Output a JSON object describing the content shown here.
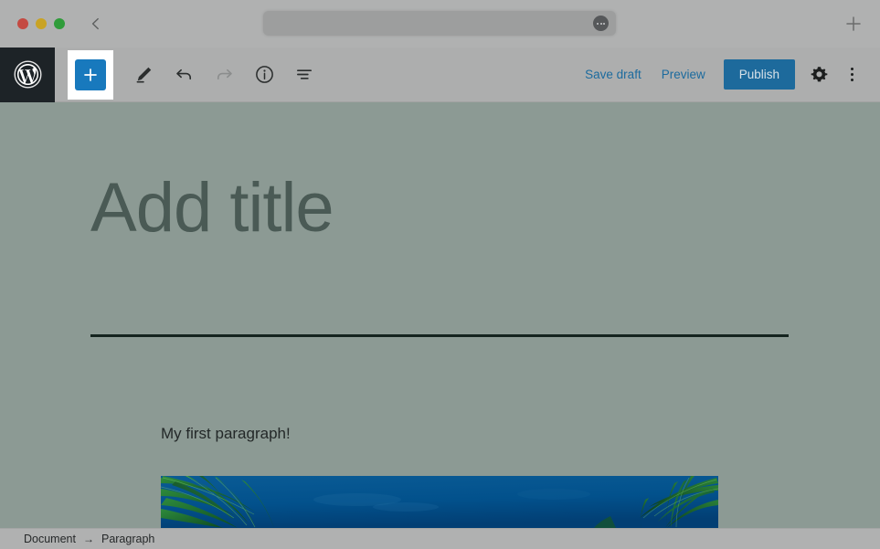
{
  "browser": {
    "traffic_lights": [
      {
        "name": "close",
        "color": "#c44a42"
      },
      {
        "name": "minimize",
        "color": "#c9a324"
      },
      {
        "name": "maximize",
        "color": "#2f9c3a"
      }
    ],
    "back_icon": "chevron-left-icon",
    "address_bar": {
      "value": "",
      "placeholder": "",
      "menu_icon": "ellipsis-icon"
    },
    "new_tab_icon": "plus-icon"
  },
  "editor_header": {
    "logo_icon": "wordpress-logo-icon",
    "left_tools": [
      {
        "name": "block-inserter",
        "icon": "plus-icon",
        "label": "Add block",
        "state": "focused"
      },
      {
        "name": "tools-mode",
        "icon": "pencil-icon",
        "label": "Tools"
      },
      {
        "name": "undo",
        "icon": "undo-icon",
        "label": "Undo",
        "state": "enabled"
      },
      {
        "name": "redo",
        "icon": "redo-icon",
        "label": "Redo",
        "state": "disabled"
      },
      {
        "name": "details",
        "icon": "info-icon",
        "label": "Details"
      },
      {
        "name": "list-view",
        "icon": "list-view-icon",
        "label": "List view"
      }
    ],
    "save_draft_label": "Save draft",
    "preview_label": "Preview",
    "publish_label": "Publish",
    "settings_icon": "gear-icon",
    "more_menu_icon": "kebab-menu-icon",
    "accent_color": "#1879bd",
    "publish_color": "#1d6a9c",
    "link_color": "#1c6b9e"
  },
  "canvas": {
    "title_placeholder": "Add title",
    "paragraph_text": "My first paragraph!",
    "image_block": {
      "name": "palm-tree-image",
      "alt": "Palm fronds against a deep blue sky",
      "sky_color": "#024a80",
      "frond_color": "#14632a"
    },
    "background_color": "#8c9a94",
    "divider_color": "#15241f"
  },
  "status_bar": {
    "breadcrumb": [
      {
        "label": "Document"
      },
      {
        "label": "Paragraph"
      }
    ],
    "separator": "→"
  }
}
